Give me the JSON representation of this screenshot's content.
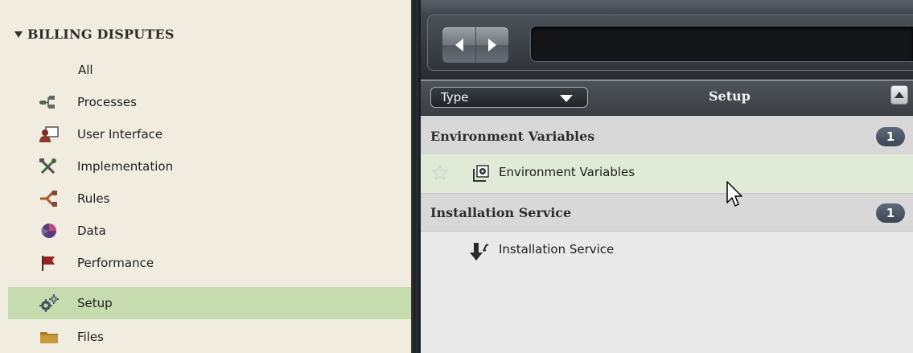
{
  "sidebar": {
    "header": "BILLING DISPUTES",
    "items": [
      {
        "label": "All",
        "icon": "none"
      },
      {
        "label": "Processes",
        "icon": "process-flow-icon"
      },
      {
        "label": "User Interface",
        "icon": "user-interface-icon"
      },
      {
        "label": "Implementation",
        "icon": "tools-icon"
      },
      {
        "label": "Rules",
        "icon": "rules-icon"
      },
      {
        "label": "Data",
        "icon": "data-icon"
      },
      {
        "label": "Performance",
        "icon": "flag-icon"
      },
      {
        "label": "Setup",
        "icon": "gears-icon",
        "selected": true
      },
      {
        "label": "Files",
        "icon": "folder-icon"
      }
    ]
  },
  "toolbar": {
    "back": "back-arrow-icon",
    "forward": "forward-arrow-icon",
    "address_value": ""
  },
  "list": {
    "type_filter": "Type",
    "column_title": "Setup",
    "groups": [
      {
        "title": "Environment Variables",
        "count": "1",
        "items": [
          {
            "label": "Environment Variables",
            "icon": "environment-variables-icon",
            "favorite": false
          }
        ]
      },
      {
        "title": "Installation Service",
        "count": "1",
        "items": [
          {
            "label": "Installation Service",
            "icon": "installation-service-icon"
          }
        ]
      }
    ]
  },
  "colors": {
    "sidebar_bg": "#f0ede0",
    "selected_bg": "#c6dcae",
    "hover_row_bg": "#e1ead6",
    "group_bg": "#d8d8d8",
    "badge_bg": "#4a5564",
    "toolbar_bg": "#2a2d32"
  }
}
